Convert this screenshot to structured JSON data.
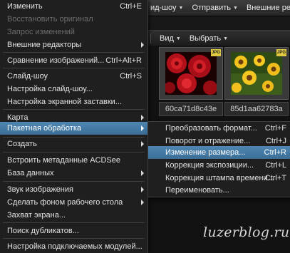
{
  "toolbar": {
    "item1": "ид-шоу",
    "item2": "Отправить",
    "item3": "Внешние реда"
  },
  "viewbar": {
    "view": "Вид",
    "select": "Выбрать"
  },
  "thumbs": [
    {
      "caption": "60ca71d8c43e",
      "badge": "JPG"
    },
    {
      "caption": "85d1aa62783a",
      "badge": "JPG"
    }
  ],
  "menu": {
    "items": [
      {
        "label": "Изменить",
        "shortcut": "Ctrl+E"
      },
      {
        "label": "Восстановить оригинал",
        "shortcut": ""
      },
      {
        "label": "Запрос изменений",
        "shortcut": ""
      },
      {
        "label": "Внешние редакторы",
        "shortcut": ""
      },
      {
        "label": "Сравнение изображений...",
        "shortcut": "Ctrl+Alt+R"
      },
      {
        "label": "Слайд-шоу",
        "shortcut": "Ctrl+S"
      },
      {
        "label": "Настройка слайд-шоу...",
        "shortcut": ""
      },
      {
        "label": "Настройка экранной заставки...",
        "shortcut": ""
      },
      {
        "label": "Карта",
        "shortcut": ""
      },
      {
        "label": "Пакетная обработка",
        "shortcut": ""
      },
      {
        "label": "Создать",
        "shortcut": ""
      },
      {
        "label": "Встроить метаданные ACDSee",
        "shortcut": ""
      },
      {
        "label": "База данных",
        "shortcut": ""
      },
      {
        "label": "Звук изображения",
        "shortcut": ""
      },
      {
        "label": "Сделать фоном рабочего стола",
        "shortcut": ""
      },
      {
        "label": "Захват экрана...",
        "shortcut": ""
      },
      {
        "label": "Поиск дубликатов...",
        "shortcut": ""
      },
      {
        "label": "Настройка подключаемых модулей...",
        "shortcut": ""
      }
    ]
  },
  "submenu": {
    "items": [
      {
        "label": "Преобразовать формат...",
        "shortcut": "Ctrl+F"
      },
      {
        "label": "Поворот и отражение...",
        "shortcut": "Ctrl+J"
      },
      {
        "label": "Изменение размера...",
        "shortcut": "Ctrl+R"
      },
      {
        "label": "Коррекция экспозиции...",
        "shortcut": "Ctrl+L"
      },
      {
        "label": "Коррекция штампа времени...",
        "shortcut": "Ctrl+T"
      },
      {
        "label": "Переименовать...",
        "shortcut": ""
      }
    ]
  },
  "watermark": "luzerblog.ru",
  "colors": {
    "highlight": "#4a80ab",
    "menu_bg": "#1f1f1f"
  }
}
